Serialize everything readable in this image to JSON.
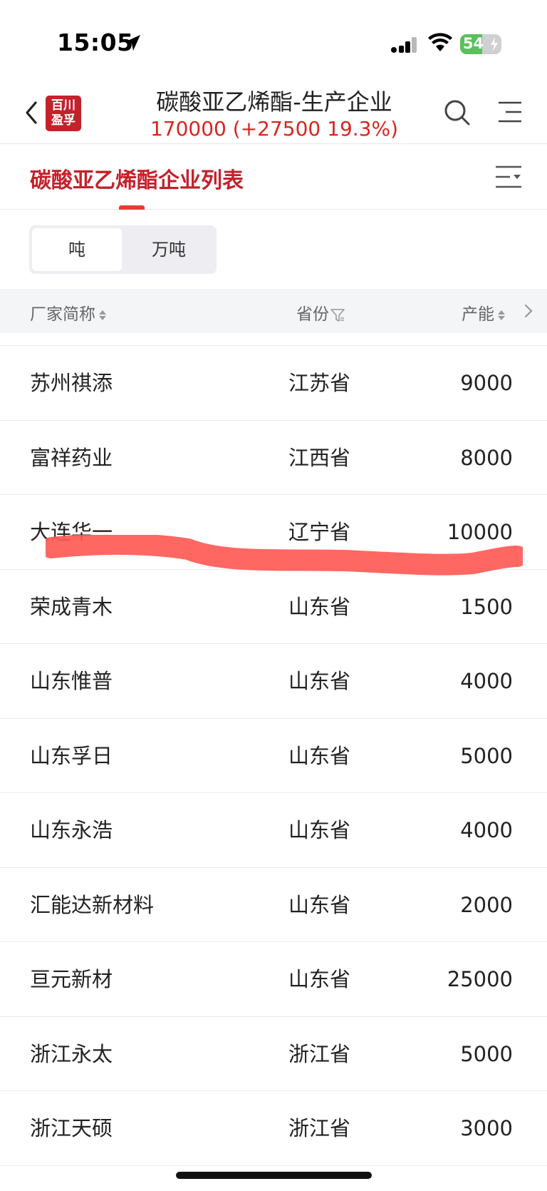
{
  "status_bar": {
    "time": "15:05",
    "battery": "54",
    "battery_level": 0.54,
    "icons": [
      "location-arrow-icon",
      "cellular-signal-icon",
      "wifi-icon",
      "battery-icon"
    ]
  },
  "header": {
    "back_icon": "chevron-left-icon",
    "logo_text": [
      "百川",
      "盈孚"
    ],
    "title": "碳酸亚乙烯酯-生产企业",
    "price_line": "170000 (+27500  19.3%)",
    "search_icon": "search-icon",
    "menu_icon": "menu-icon"
  },
  "section": {
    "title": "碳酸亚乙烯酯企业列表",
    "filter_icon": "list-filter-icon"
  },
  "unit_toggle": {
    "options": [
      "吨",
      "万吨"
    ],
    "selected": "吨"
  },
  "table": {
    "columns": {
      "name": "厂家简称",
      "province": "省份",
      "capacity": "产能"
    },
    "rows": [
      {
        "name": "苏州祺添",
        "province": "江苏省",
        "capacity": "9000"
      },
      {
        "name": "富祥药业",
        "province": "江西省",
        "capacity": "8000"
      },
      {
        "name": "大连华一",
        "province": "辽宁省",
        "capacity": "10000"
      },
      {
        "name": "荣成青木",
        "province": "山东省",
        "capacity": "1500"
      },
      {
        "name": "山东惟普",
        "province": "山东省",
        "capacity": "4000"
      },
      {
        "name": "山东孚日",
        "province": "山东省",
        "capacity": "5000"
      },
      {
        "name": "山东永浩",
        "province": "山东省",
        "capacity": "4000"
      },
      {
        "name": "汇能达新材料",
        "province": "山东省",
        "capacity": "2000"
      },
      {
        "name": "亘元新材",
        "province": "山东省",
        "capacity": "25000"
      },
      {
        "name": "浙江永太",
        "province": "浙江省",
        "capacity": "5000"
      },
      {
        "name": "浙江天硕",
        "province": "浙江省",
        "capacity": "3000"
      }
    ]
  },
  "colors": {
    "brand_red": "#c4212a",
    "price_red": "#d9251d",
    "highlight_stroke": "#ff5a55"
  }
}
